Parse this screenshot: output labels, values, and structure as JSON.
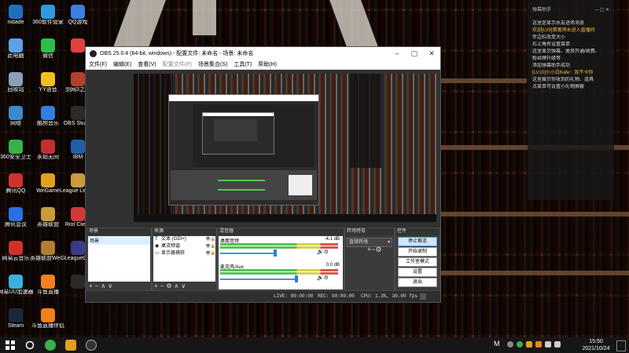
{
  "desktop_icons": [
    {
      "label": "nidade",
      "color": "#1f6fbf"
    },
    {
      "label": "360软件管家",
      "color": "#2e9be0"
    },
    {
      "label": "QQ游戏",
      "color": "#3d7fe0"
    },
    {
      "label": "此电脑",
      "color": "#5ea0e8"
    },
    {
      "label": "微信",
      "color": "#2bbf4a"
    },
    {
      "label": "",
      "color": "#e04040"
    },
    {
      "label": "回收站",
      "color": "#8aa0b8"
    },
    {
      "label": "YY语音",
      "color": "#f0c020"
    },
    {
      "label": "剑网3之主",
      "color": "#b04030"
    },
    {
      "label": "网络",
      "color": "#3a8ad0"
    },
    {
      "label": "酷狗音乐",
      "color": "#2f7fe0"
    },
    {
      "label": "OBS Studio",
      "color": "#2a2a2a"
    },
    {
      "label": "360安全卫士",
      "color": "#3cb04a"
    },
    {
      "label": "永劫无间",
      "color": "#c03030"
    },
    {
      "label": "IBM",
      "color": "#1f5fa8"
    },
    {
      "label": "腾讯QQ",
      "color": "#d03030"
    },
    {
      "label": "WeGame",
      "color": "#e0a020"
    },
    {
      "label": "League Legends",
      "color": "#c89b3c"
    },
    {
      "label": "腾讯会议",
      "color": "#2a6fe0"
    },
    {
      "label": "英雄联盟",
      "color": "#c89b3c"
    },
    {
      "label": "Riot Client",
      "color": "#d03a3a"
    },
    {
      "label": "网易云音乐",
      "color": "#d0302a"
    },
    {
      "label": "英雄联盟WeGame版",
      "color": "#b08030"
    },
    {
      "label": "LeagueC...",
      "color": "#3a3a8a"
    },
    {
      "label": "网易UU加速器",
      "color": "#3ab0e0"
    },
    {
      "label": "斗鱼直播",
      "color": "#f08020"
    },
    {
      "label": "",
      "color": "#2a2a2a"
    },
    {
      "label": "Steam",
      "color": "#1b2838"
    },
    {
      "label": "斗鱼直播伴侣",
      "color": "#f08020"
    }
  ],
  "chat": {
    "header": "弹幕助手",
    "lines": [
      "这里是显示水友进场消息",
      "欢迎[LV9]蛋黄鸽长进入直播间",
      "",
      "",
      "",
      "",
      "",
      "伴边栏改变大小",
      "右上角有设置菜单",
      "这里显示弹幕、类资开通/续费、",
      "粉丝牌升级等",
      "添加弹幕助手成功",
      "[LV10]小小白Kafe：我不卡你",
      "这里展示你收到的礼物、道具",
      "",
      "点菜单可设置小礼物屏蔽"
    ]
  },
  "obs": {
    "title": "OBS 25.0.4 (64-bit, windows) - 配置文件: 未命名 - 场景: 未命名",
    "menu": [
      "文件(F)",
      "编辑(E)",
      "查看(V)",
      "配置文件(P)",
      "场景集合(S)",
      "工具(T)",
      "帮助(H)"
    ],
    "docks": {
      "scenes": {
        "title": "场景",
        "items": [
          "场景"
        ]
      },
      "sources": {
        "title": "来源",
        "items": [
          {
            "icon": "T",
            "name": "文本 (GDI+)"
          },
          {
            "icon": "◉",
            "name": "桌流频谐"
          },
          {
            "icon": "▭",
            "name": "显示器捕获"
          }
        ]
      },
      "mixer": {
        "title": "混音器",
        "channels": [
          {
            "name": "桌面音频",
            "db": "-4.1 dB",
            "level": 0.72
          },
          {
            "name": "麦克风/Aux",
            "db": "0.0 dB",
            "level": 1.0
          }
        ]
      },
      "transitions": {
        "title": "转场特效",
        "selected": "直接转场"
      },
      "controls": {
        "title": "控件",
        "buttons": [
          "停止推流",
          "开始录制",
          "工作室模式",
          "设置",
          "退出"
        ]
      }
    },
    "status": {
      "live": "LIVE: 00:00:00",
      "rec": "REC: 00:00:00",
      "cpu": "CPU: 1.3%, 30.00 fps"
    }
  },
  "taskbar": {
    "time": "15:50",
    "date": "2021/10/24",
    "lang": "M"
  }
}
